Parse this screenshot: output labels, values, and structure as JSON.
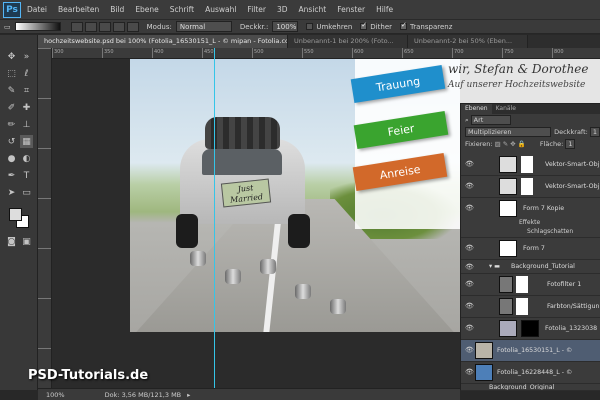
{
  "app": {
    "logo": "Ps",
    "accent": "#54b5f5"
  },
  "menu": [
    "Datei",
    "Bearbeiten",
    "Bild",
    "Ebene",
    "Schrift",
    "Auswahl",
    "Filter",
    "3D",
    "Ansicht",
    "Fenster",
    "Hilfe"
  ],
  "options": {
    "modus_label": "Modus:",
    "modus_value": "Normal",
    "deckkraft_label": "Deckkr.:",
    "deckkraft_value": "100%",
    "umkehren": "Umkehren",
    "dither": "Dither",
    "transparenz": "Transparenz"
  },
  "tabs": [
    "hochzeitswebsite.psd bei 100% (Fotolia_16530151_L - © mipan - Fotolia.com, RGB/8) *",
    "Unbenannt-1 bei 200% (Foto...",
    "Unbenannt-2 bei 50% (Eben..."
  ],
  "ruler": [
    "300",
    "350",
    "400",
    "450",
    "500",
    "550",
    "600",
    "650",
    "700",
    "750",
    "800"
  ],
  "canvas": {
    "title": "wir, Stefan & Dorothee",
    "subtitle": "Auf unserer Hochzeitswebsite",
    "plate": "Just Married",
    "ribbons": [
      {
        "label": "Trauung",
        "color": "#1f8fcc"
      },
      {
        "label": "Feier",
        "color": "#3aa42f"
      },
      {
        "label": "Anreise",
        "color": "#d2692a"
      }
    ]
  },
  "layers_panel": {
    "tabs": [
      "Ebenen",
      "Kanäle"
    ],
    "filter": "Art",
    "blend": "Multiplizieren",
    "opacity_label": "Deckkraft:",
    "opacity_value": "1",
    "fix_label": "Fixieren:",
    "fill_label": "Fläche:",
    "fill_value": "1",
    "layers": [
      {
        "name": "Vektor-Smart-Obj"
      },
      {
        "name": "Vektor-Smart-Obj"
      },
      {
        "name": "Form 7 Kopie"
      },
      {
        "name": "Effekte"
      },
      {
        "name": "Schlagschatten"
      },
      {
        "name": "Form 7"
      },
      {
        "name": "Background_Tutorial"
      },
      {
        "name": "Fotofilter 1"
      },
      {
        "name": "Farbton/Sättigun"
      },
      {
        "name": "Fotolia_1323038"
      },
      {
        "name": "Fotolia_16530151_L - ©"
      },
      {
        "name": "Fotolia_16228448_L - ©"
      },
      {
        "name": "Background_Original"
      }
    ]
  },
  "status": {
    "zoom": "100%",
    "doc": "Dok: 3,56 MB/121,3 MB"
  },
  "watermark": "PSD-Tutorials.de"
}
